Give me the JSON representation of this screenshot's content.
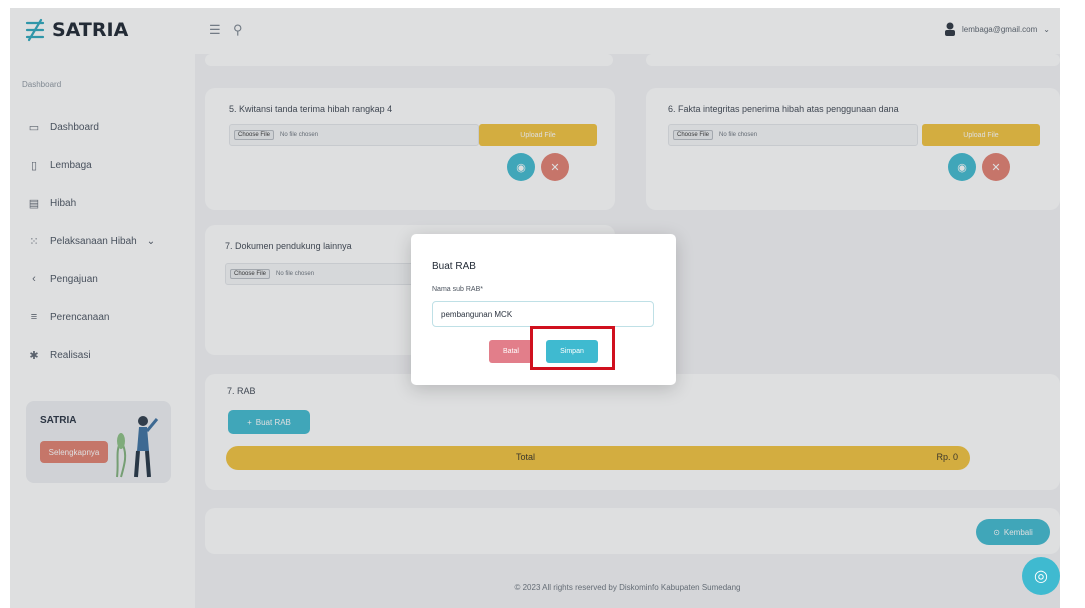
{
  "app": {
    "name": "SATRIA"
  },
  "sidebar": {
    "heading": "Dashboard",
    "items": [
      {
        "label": "Dashboard",
        "icon": "monitor-icon"
      },
      {
        "label": "Lembaga",
        "icon": "document-icon"
      },
      {
        "label": "Hibah",
        "icon": "calendar-icon"
      },
      {
        "label": "Pelaksanaan Hibah",
        "icon": "grid-icon",
        "chevron": "⌄"
      },
      {
        "label": "Pengajuan",
        "icon": "arrow-icon"
      },
      {
        "label": "Perencanaan",
        "icon": "list-icon"
      },
      {
        "label": "Realisasi",
        "icon": "star-icon"
      }
    ],
    "promo": {
      "title": "SATRIA",
      "button": "Selengkapnya"
    }
  },
  "topbar": {
    "user_email": "lembaga@gmail.com"
  },
  "cards": {
    "doc5": {
      "label": "5. Kwitansi tanda terima hibah rangkap 4",
      "upload_label": "Upload File"
    },
    "doc6": {
      "label": "6. Fakta integritas penerima hibah atas penggunaan dana",
      "upload_label": "Upload File"
    },
    "doc7": {
      "label": "7. Dokumen pendukung lainnya"
    },
    "file_input": {
      "button": "Choose File",
      "status": "No file chosen"
    },
    "rab": {
      "label": "7. RAB",
      "add_button": "Buat RAB",
      "total_label": "Total",
      "total_value": "Rp. 0"
    }
  },
  "kembali_label": "Kembali",
  "footer": "© 2023 All rights reserved by Diskominfo Kabupaten Sumedang",
  "modal": {
    "title": "Buat RAB",
    "field_label": "Nama sub RAB*",
    "field_value": "pembangunan MCK",
    "cancel": "Batal",
    "save": "Simpan"
  },
  "colors": {
    "accent": "#3fbad0",
    "warning": "#f2c33c",
    "danger": "#e27e6f",
    "highlight": "#d0101e"
  }
}
